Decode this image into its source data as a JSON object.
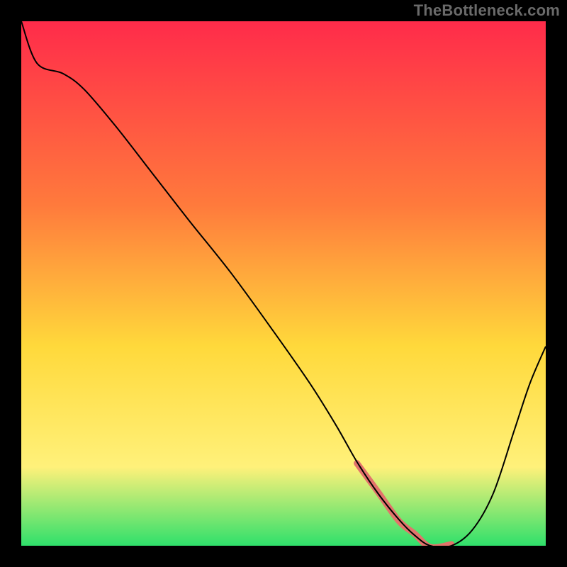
{
  "watermark": "TheBottleneck.com",
  "colors": {
    "gradient_top": "#ff2b4a",
    "gradient_mid1": "#ff7a3c",
    "gradient_mid2": "#ffd93b",
    "gradient_mid3": "#fff17a",
    "gradient_bottom": "#2fe06b",
    "curve": "#000000",
    "highlight": "#e2736b",
    "frame": "#000000"
  },
  "chart_data": {
    "type": "line",
    "title": "",
    "xlabel": "",
    "ylabel": "",
    "xlim": [
      0,
      100
    ],
    "ylim": [
      0,
      100
    ],
    "grid": false,
    "legend": false,
    "annotations": [],
    "x": [
      0,
      3,
      8,
      12,
      18,
      25,
      32,
      40,
      48,
      55,
      60,
      64,
      68,
      72,
      75,
      78,
      82,
      86,
      90,
      94,
      97,
      100
    ],
    "values": [
      100,
      92,
      90,
      87,
      80,
      71,
      62,
      52,
      41,
      31,
      23,
      16,
      10,
      5,
      2,
      0,
      0,
      3,
      10,
      22,
      31,
      38
    ],
    "highlight_range_x": [
      62,
      82
    ],
    "note": "Single curve on a vertical red→yellow→green gradient background. Highlighted segment near the minimum (~x 62–82, y ~0). y=100 is top (high bottleneck), y=0 is bottom (no bottleneck)."
  }
}
